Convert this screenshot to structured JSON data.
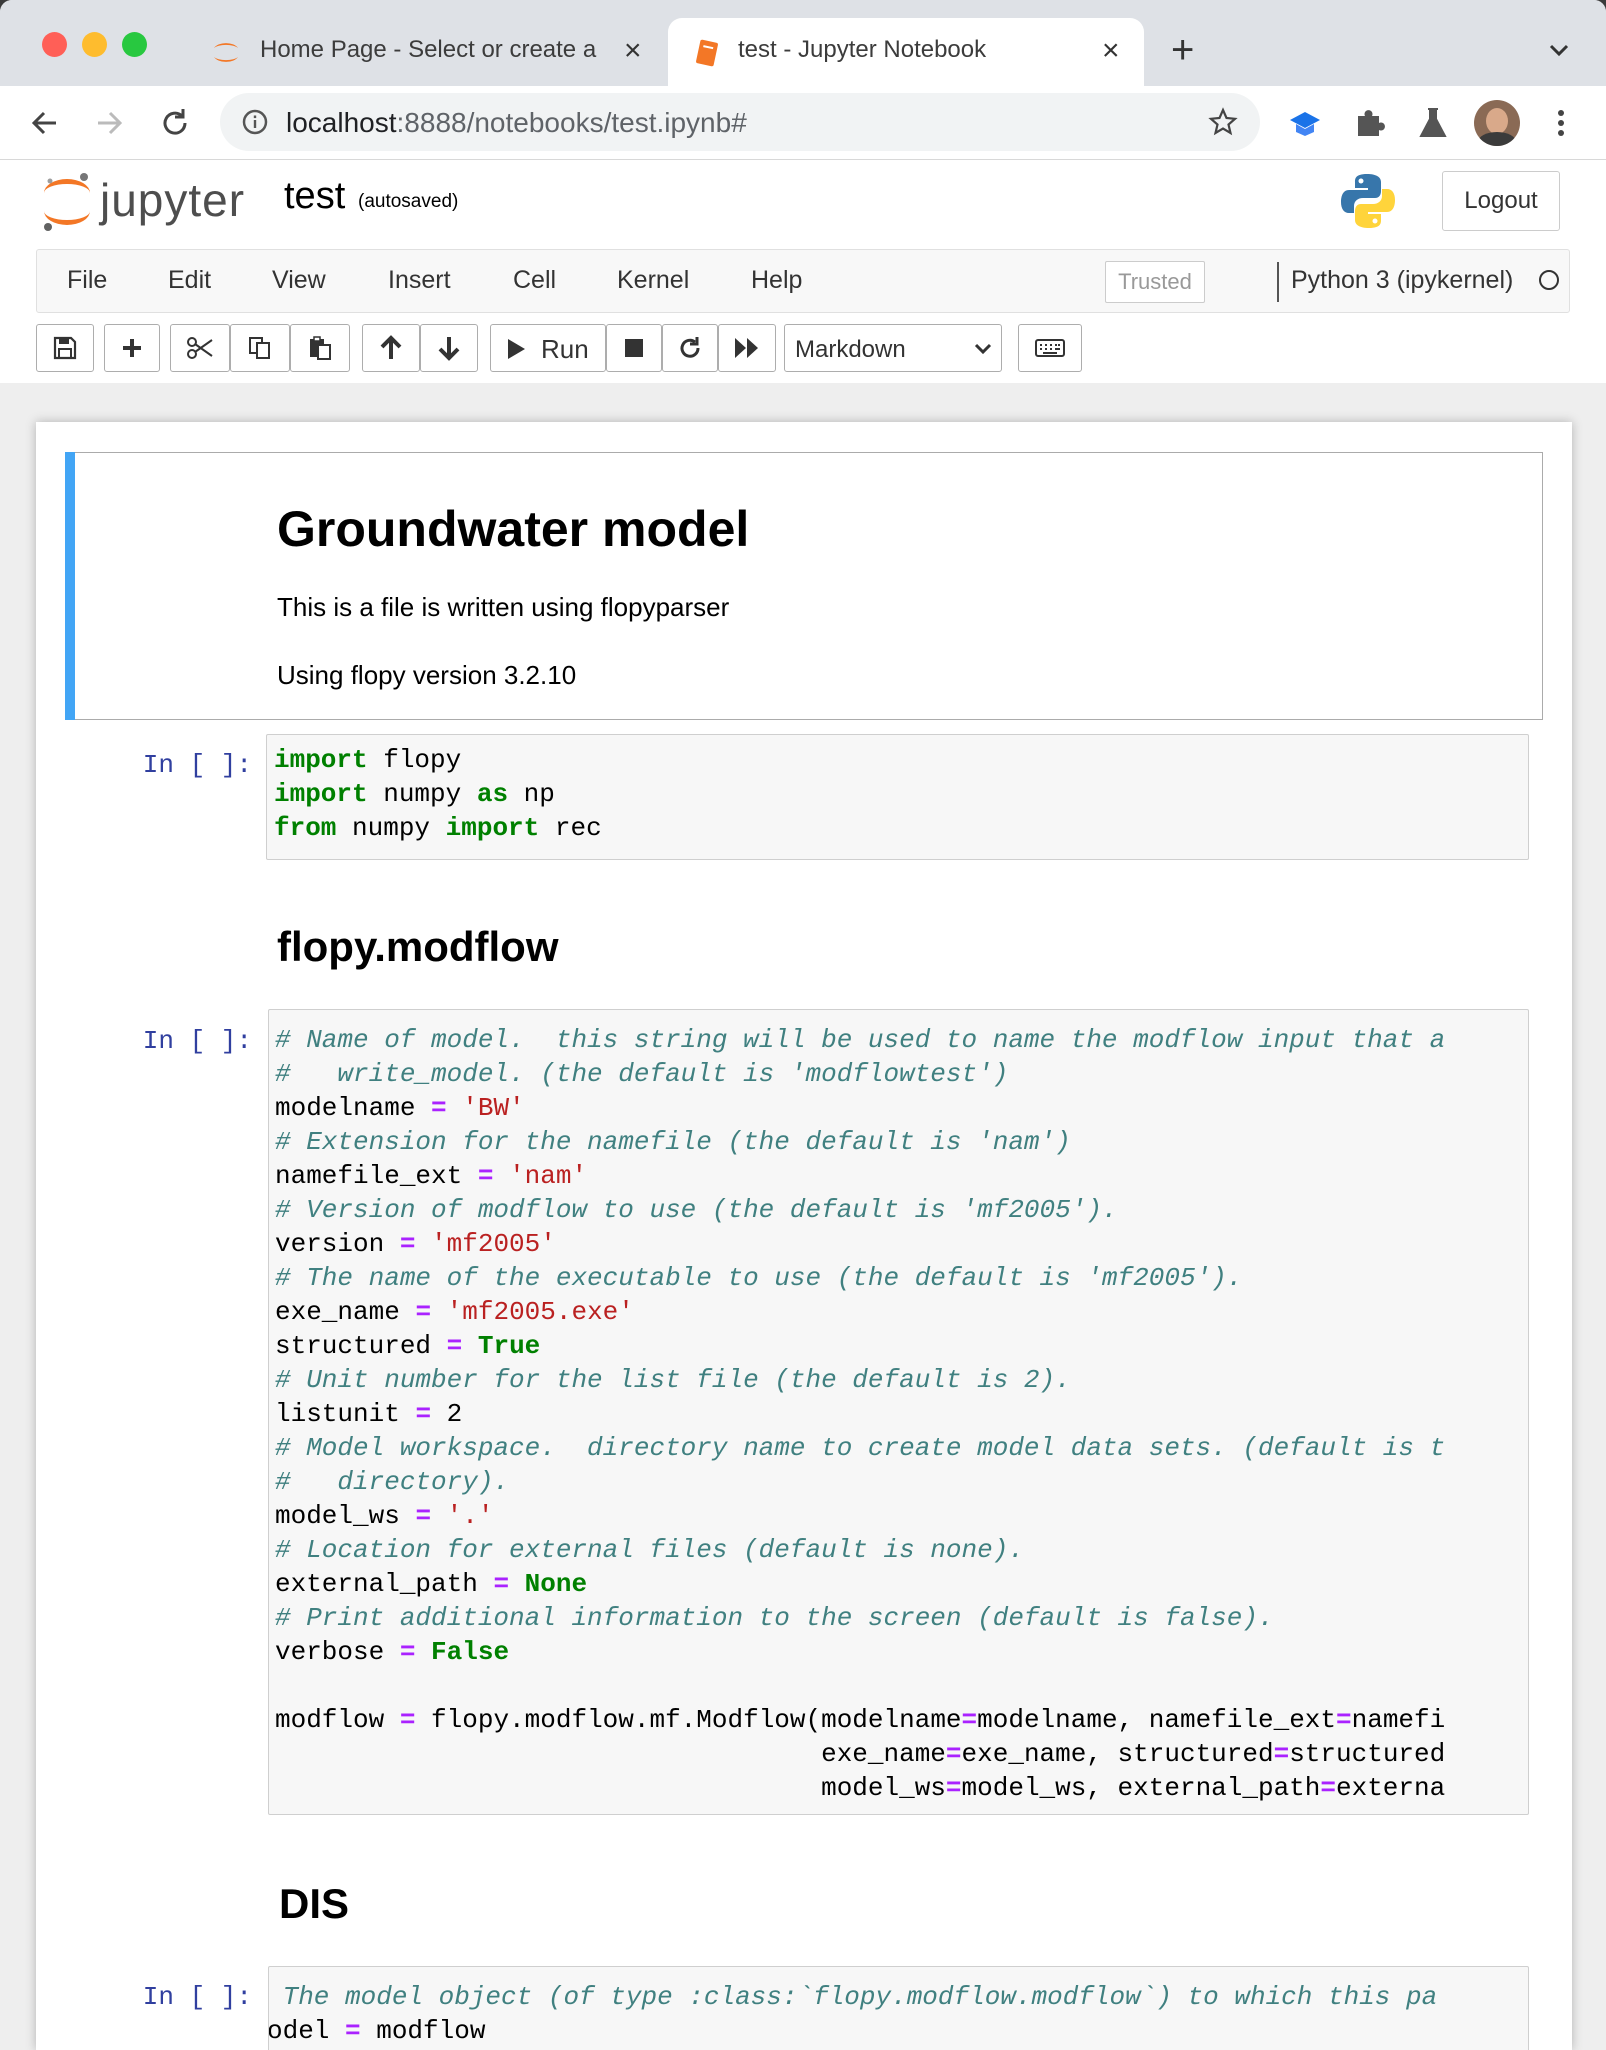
{
  "browser": {
    "tabs": [
      {
        "title": "Home Page - Select or create a",
        "active": false
      },
      {
        "title": "test - Jupyter Notebook",
        "active": true
      }
    ],
    "url_host": "localhost",
    "url_rest": ":8888/notebooks/test.ipynb#"
  },
  "header": {
    "logo_word": "jupyter",
    "notebook_title": "test",
    "autosave_status": "(autosaved)",
    "logout_label": "Logout"
  },
  "menubar": {
    "items": [
      "File",
      "Edit",
      "View",
      "Insert",
      "Cell",
      "Kernel",
      "Help"
    ],
    "trusted_label": "Trusted",
    "kernel_name": "Python 3 (ipykernel)"
  },
  "toolbar": {
    "run_label": "Run",
    "cell_type": "Markdown"
  },
  "cells": {
    "md1": {
      "heading": "Groundwater model",
      "para1": "This is a file is written using flopyparser",
      "para2": "Using flopy version 3.2.10"
    },
    "prompt": "In [ ]:",
    "heading_modflow": "flopy.modflow",
    "heading_dis": "DIS",
    "code1": [
      [
        [
          "import",
          "kw"
        ],
        [
          " flopy",
          "n"
        ]
      ],
      [
        [
          "import",
          "kw"
        ],
        [
          " numpy ",
          "n"
        ],
        [
          "as",
          "kw"
        ],
        [
          " np",
          "n"
        ]
      ],
      [
        [
          "from",
          "kw"
        ],
        [
          " numpy ",
          "n"
        ],
        [
          "import",
          "kw"
        ],
        [
          " rec",
          "n"
        ]
      ]
    ],
    "code2": [
      [
        [
          "# Name of model.  this string will be used to name the modflow input that a",
          "com"
        ]
      ],
      [
        [
          "#   write_model. (the default is 'modflowtest')",
          "com"
        ]
      ],
      [
        [
          "modelname ",
          "n"
        ],
        [
          "=",
          "op"
        ],
        [
          " ",
          "n"
        ],
        [
          "'BW'",
          "str"
        ]
      ],
      [
        [
          "# Extension for the namefile (the default is 'nam')",
          "com"
        ]
      ],
      [
        [
          "namefile_ext ",
          "n"
        ],
        [
          "=",
          "op"
        ],
        [
          " ",
          "n"
        ],
        [
          "'nam'",
          "str"
        ]
      ],
      [
        [
          "# Version of modflow to use (the default is 'mf2005').",
          "com"
        ]
      ],
      [
        [
          "version ",
          "n"
        ],
        [
          "=",
          "op"
        ],
        [
          " ",
          "n"
        ],
        [
          "'mf2005'",
          "str"
        ]
      ],
      [
        [
          "# The name of the executable to use (the default is 'mf2005').",
          "com"
        ]
      ],
      [
        [
          "exe_name ",
          "n"
        ],
        [
          "=",
          "op"
        ],
        [
          " ",
          "n"
        ],
        [
          "'mf2005.exe'",
          "str"
        ]
      ],
      [
        [
          "structured ",
          "n"
        ],
        [
          "=",
          "op"
        ],
        [
          " ",
          "n"
        ],
        [
          "True",
          "kw"
        ]
      ],
      [
        [
          "# Unit number for the list file (the default is 2).",
          "com"
        ]
      ],
      [
        [
          "listunit ",
          "n"
        ],
        [
          "=",
          "op"
        ],
        [
          " 2",
          "n"
        ]
      ],
      [
        [
          "# Model workspace.  directory name to create model data sets. (default is t",
          "com"
        ]
      ],
      [
        [
          "#   directory).",
          "com"
        ]
      ],
      [
        [
          "model_ws ",
          "n"
        ],
        [
          "=",
          "op"
        ],
        [
          " ",
          "n"
        ],
        [
          "'.'",
          "str"
        ]
      ],
      [
        [
          "# Location for external files (default is none).",
          "com"
        ]
      ],
      [
        [
          "external_path ",
          "n"
        ],
        [
          "=",
          "op"
        ],
        [
          " ",
          "n"
        ],
        [
          "None",
          "kw"
        ]
      ],
      [
        [
          "# Print additional information to the screen (default is false).",
          "com"
        ]
      ],
      [
        [
          "verbose ",
          "n"
        ],
        [
          "=",
          "op"
        ],
        [
          " ",
          "n"
        ],
        [
          "False",
          "kw"
        ]
      ],
      [
        [
          "",
          "n"
        ]
      ],
      [
        [
          "modflow ",
          "n"
        ],
        [
          "=",
          "op"
        ],
        [
          " flopy.modflow.mf.Modflow(modelname",
          "n"
        ],
        [
          "=",
          "op"
        ],
        [
          "modelname, namefile_ext",
          "n"
        ],
        [
          "=",
          "op"
        ],
        [
          "namefi",
          "n"
        ]
      ],
      [
        [
          "                                   exe_name",
          "n"
        ],
        [
          "=",
          "op"
        ],
        [
          "exe_name, structured",
          "n"
        ],
        [
          "=",
          "op"
        ],
        [
          "structured",
          "n"
        ]
      ],
      [
        [
          "                                   model_ws",
          "n"
        ],
        [
          "=",
          "op"
        ],
        [
          "model_ws, external_path",
          "n"
        ],
        [
          "=",
          "op"
        ],
        [
          "externa",
          "n"
        ]
      ]
    ],
    "code3": [
      [
        [
          " The model object (of type :class:`flopy.modflow.modflow`) to which this pa",
          "com"
        ]
      ],
      [
        [
          "odel ",
          "n"
        ],
        [
          "=",
          "op"
        ],
        [
          " modflow",
          "n"
        ]
      ]
    ]
  }
}
